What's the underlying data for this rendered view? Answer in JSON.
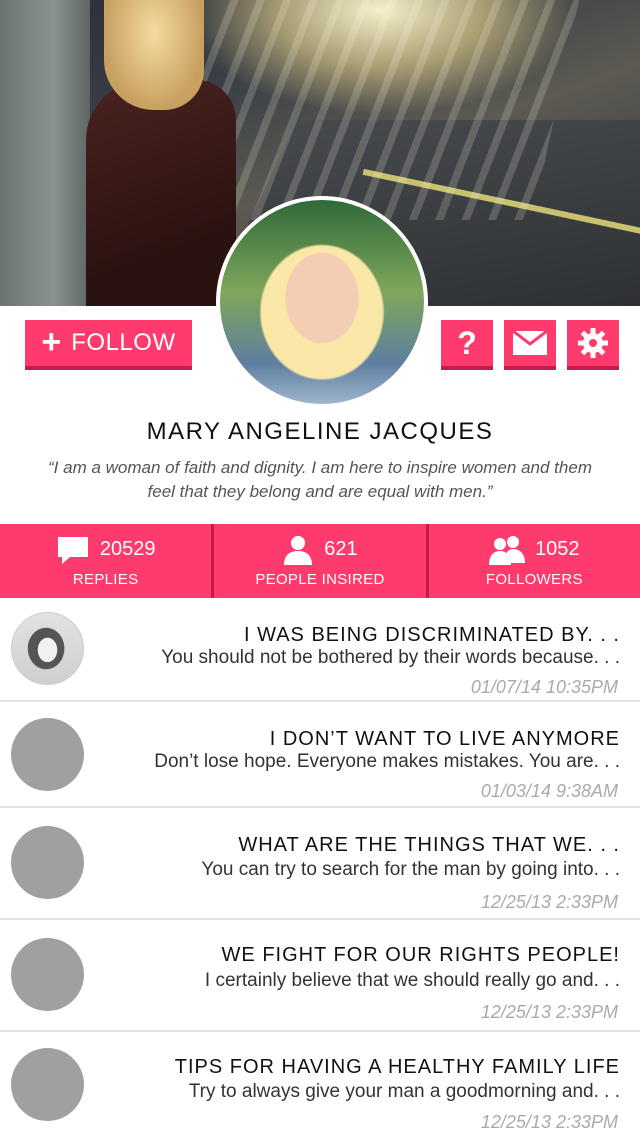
{
  "profile": {
    "name": "MARY ANGELINE JACQUES",
    "bio": "“I am a woman of faith and dignity. I am here to inspire women and them feel that they belong and are equal with men.”"
  },
  "actions": {
    "follow_icon": "plus-icon",
    "follow_label": "FOLLOW",
    "help_glyph": "?",
    "help_icon": "question-icon",
    "mail_icon": "mail-icon",
    "settings_icon": "gear-icon"
  },
  "stats": [
    {
      "icon": "speech-bubble-icon",
      "value": "20529",
      "label": "REPLIES"
    },
    {
      "icon": "person-icon",
      "value": "621",
      "label": "PEOPLE INSIRED"
    },
    {
      "icon": "people-icon",
      "value": "1052",
      "label": "FOLLOWERS"
    }
  ],
  "posts": [
    {
      "title": "I WAS BEING DISCRIMINATED BY. . .",
      "excerpt": "You should not be bothered by their words because. . .",
      "time": "01/07/14 10:35PM",
      "avatar": "photo"
    },
    {
      "title": "I DON’T WANT TO LIVE ANYMORE",
      "excerpt": "Don’t lose hope. Everyone makes mistakes. You are. . .",
      "time": "01/03/14 9:38AM",
      "avatar": "placeholder"
    },
    {
      "title": "WHAT ARE THE THINGS THAT WE. . .",
      "excerpt": "You can try to search for the man by going into. . .",
      "time": "12/25/13 2:33PM",
      "avatar": "placeholder"
    },
    {
      "title": "WE FIGHT FOR OUR RIGHTS PEOPLE!",
      "excerpt": "I certainly believe that we should really go and. . .",
      "time": "12/25/13 2:33PM",
      "avatar": "placeholder"
    },
    {
      "title": "TIPS FOR HAVING A HEALTHY FAMILY LIFE",
      "excerpt": "Try to always give your man a goodmorning and. . .",
      "time": "12/25/13 2:33PM",
      "avatar": "placeholder"
    }
  ],
  "colors": {
    "accent": "#ff3a6d",
    "accent_dark": "#c21e4c",
    "timestamp": "#aaaaaa",
    "placeholder_avatar": "#a0a0a0"
  }
}
